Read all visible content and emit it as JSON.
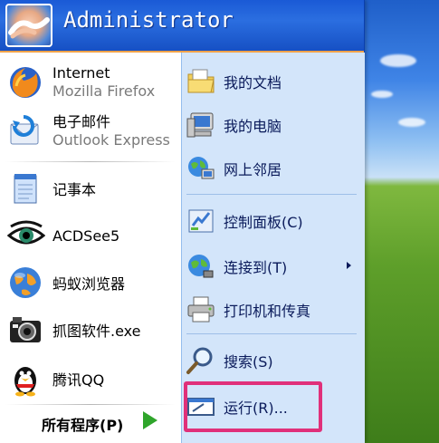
{
  "user": {
    "name": "Administrator"
  },
  "pinned": [
    {
      "primary": "Internet",
      "secondary": "Mozilla Firefox",
      "icon": "firefox-icon"
    },
    {
      "primary": "电子邮件",
      "secondary": "Outlook Express",
      "icon": "outlook-express-icon"
    }
  ],
  "recent": [
    {
      "label": "记事本",
      "icon": "notepad-icon"
    },
    {
      "label": "ACDSee5",
      "icon": "acdsee-eye-icon"
    },
    {
      "label": "蚂蚁浏览器",
      "icon": "globe-browser-icon"
    },
    {
      "label": "抓图软件.exe",
      "icon": "camera-icon"
    },
    {
      "label": "腾讯QQ",
      "icon": "qq-penguin-icon"
    }
  ],
  "all_programs": {
    "label": "所有程序(P)"
  },
  "right_items": [
    {
      "label": "我的文档",
      "icon": "my-documents-icon"
    },
    {
      "label": "我的电脑",
      "icon": "my-computer-icon"
    },
    {
      "label": "网上邻居",
      "icon": "network-places-icon"
    },
    {
      "label": "控制面板(C)",
      "icon": "control-panel-icon"
    },
    {
      "label": "连接到(T)",
      "icon": "connect-to-icon"
    },
    {
      "label": "打印机和传真",
      "icon": "printers-faxes-icon"
    },
    {
      "label": "搜索(S)",
      "icon": "search-icon"
    },
    {
      "label": "运行(R)...",
      "icon": "run-icon"
    }
  ],
  "colors": {
    "header": "#1a5ad6",
    "right_pane": "#d3e5fa",
    "highlight": "#e0307a",
    "arrow": "#2fa52b"
  }
}
